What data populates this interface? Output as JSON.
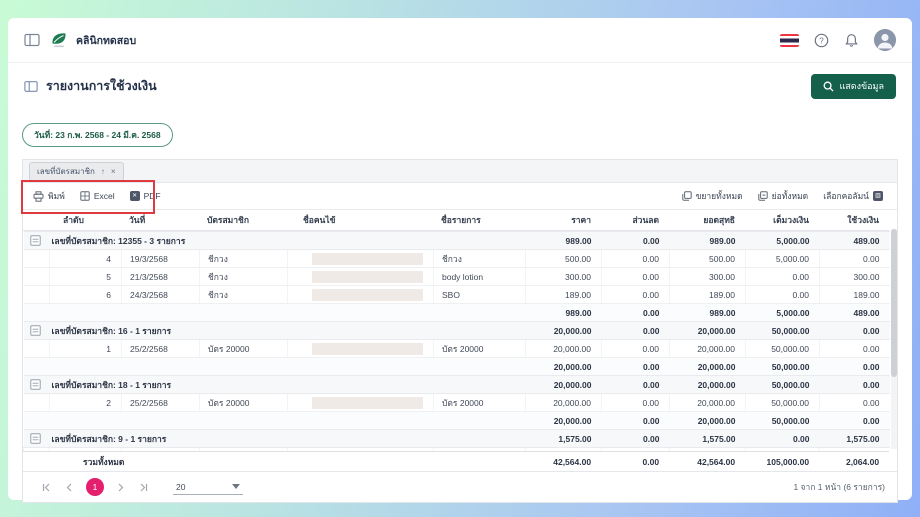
{
  "topbar": {
    "clinic_name": "คลินิกทดสอบ"
  },
  "page": {
    "title": "รายงานการใช้วงเงิน",
    "show_data_label": "แสดงข้อมูล"
  },
  "filters": {
    "date_range": "วันที่: 23 ก.พ. 2568 - 24 มี.ค. 2568",
    "group_chip_label": "เลขที่บัตรสมาชิก",
    "group_chip_sort": "↑",
    "group_chip_remove": "×"
  },
  "toolbar": {
    "print_label": "พิมพ์",
    "excel_label": "Excel",
    "pdf_label": "PDF",
    "expand_all_label": "ขยายทั้งหมด",
    "collapse_all_label": "ย่อทั้งหมด",
    "choose_columns_label": "เลือกคอลัมน์"
  },
  "table": {
    "columns": [
      "ลำดับ",
      "วันที่",
      "บัตรสมาชิก",
      "ชื่อคนไข้",
      "ชื่อรายการ",
      "ราคา",
      "ส่วนลด",
      "ยอดสุทธิ",
      "เต็มวงเงิน",
      "ใช้วงเงิน"
    ],
    "groups": [
      {
        "label": "เลขที่บัตรสมาชิก: 12355 - 3 รายการ",
        "totals": [
          "989.00",
          "0.00",
          "989.00",
          "5,000.00",
          "489.00"
        ],
        "rows": [
          {
            "order": "4",
            "date": "19/3/2568",
            "card": "ชีกวง",
            "item": "ชีกวง",
            "values": [
              "500.00",
              "0.00",
              "500.00",
              "5,000.00",
              "0.00"
            ]
          },
          {
            "order": "5",
            "date": "21/3/2568",
            "card": "ชีกวง",
            "item": "body lotion",
            "values": [
              "300.00",
              "0.00",
              "300.00",
              "0.00",
              "300.00"
            ]
          },
          {
            "order": "6",
            "date": "24/3/2568",
            "card": "ชีกวง",
            "item": "SBO",
            "values": [
              "189.00",
              "0.00",
              "189.00",
              "0.00",
              "189.00"
            ]
          }
        ],
        "subtotal": [
          "989.00",
          "0.00",
          "989.00",
          "5,000.00",
          "489.00"
        ]
      },
      {
        "label": "เลขที่บัตรสมาชิก: 16 - 1 รายการ",
        "totals": [
          "20,000.00",
          "0.00",
          "20,000.00",
          "50,000.00",
          "0.00"
        ],
        "rows": [
          {
            "order": "1",
            "date": "25/2/2568",
            "card": "บัตร 20000",
            "item": "บัตร 20000",
            "values": [
              "20,000.00",
              "0.00",
              "20,000.00",
              "50,000.00",
              "0.00"
            ]
          }
        ],
        "subtotal": [
          "20,000.00",
          "0.00",
          "20,000.00",
          "50,000.00",
          "0.00"
        ]
      },
      {
        "label": "เลขที่บัตรสมาชิก: 18 - 1 รายการ",
        "totals": [
          "20,000.00",
          "0.00",
          "20,000.00",
          "50,000.00",
          "0.00"
        ],
        "rows": [
          {
            "order": "2",
            "date": "25/2/2568",
            "card": "บัตร 20000",
            "item": "บัตร 20000",
            "values": [
              "20,000.00",
              "0.00",
              "20,000.00",
              "50,000.00",
              "0.00"
            ]
          }
        ],
        "subtotal": [
          "20,000.00",
          "0.00",
          "20,000.00",
          "50,000.00",
          "0.00"
        ]
      },
      {
        "label": "เลขที่บัตรสมาชิก: 9 - 1 รายการ",
        "totals": [
          "1,575.00",
          "0.00",
          "1,575.00",
          "0.00",
          "1,575.00"
        ],
        "rows": [],
        "subtotal": []
      }
    ],
    "grand_total_label": "รวมทั้งหมด",
    "grand_total": [
      "42,564.00",
      "0.00",
      "42,564.00",
      "105,000.00",
      "2,064.00"
    ]
  },
  "pagination": {
    "current_page": "1",
    "page_size": "20",
    "info": "1 จาก 1 หน้า (6 รายการ)"
  },
  "colors": {
    "accent_green": "#15604b",
    "date_chip_green": "#1d5c47",
    "annotation_red": "#de3a40",
    "pagination_active_pink": "#e41f6e"
  }
}
